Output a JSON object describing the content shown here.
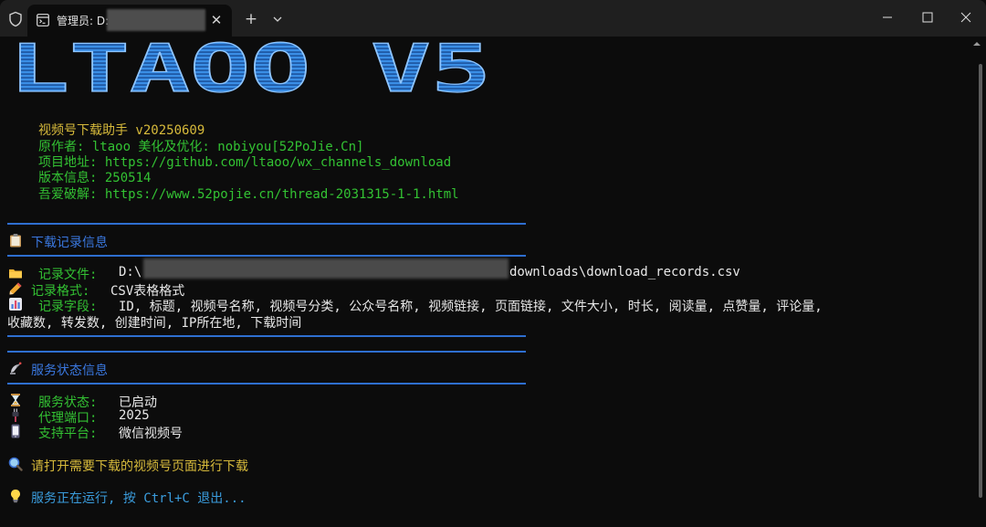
{
  "tab": {
    "title": "管理员: D:\\",
    "close": "✕",
    "new_tab": "+"
  },
  "logo": {
    "text": "LTAOO V5"
  },
  "info": {
    "name": "视频号下载助手 v20250609",
    "author": "原作者: ltaoo   美化及优化: nobiyou[52PoJie.Cn]",
    "project": "项目地址: https://github.com/ltaoo/wx_channels_download",
    "version": "版本信息: 250514",
    "wuai": "吾爱破解: https://www.52pojie.cn/thread-2031315-1-1.html"
  },
  "download_section": {
    "header": "下载记录信息",
    "file_label": "记录文件:",
    "file_prefix": "D:\\",
    "file_suffix": "downloads\\download_records.csv",
    "format_label": "记录格式:",
    "format_value": "CSV表格格式",
    "fields_label": "记录字段:",
    "fields_line1": "ID, 标题, 视频号名称, 视频号分类, 公众号名称, 视频链接, 页面链接, 文件大小, 时长, 阅读量, 点赞量, 评论量,",
    "fields_line2": "收藏数, 转发数, 创建时间, IP所在地, 下载时间"
  },
  "service_section": {
    "header": "服务状态信息",
    "status_label": "服务状态:",
    "status_value": "已启动",
    "port_label": "代理端口:",
    "port_value": "2025",
    "platform_label": "支持平台:",
    "platform_value": "微信视频号"
  },
  "prompt": "请打开需要下载的视频号页面进行下载",
  "running": "服务正在运行, 按 Ctrl+C 退出...",
  "colors": {
    "yellow": "#d7ba3b",
    "green": "#33c233",
    "blue": "#3a78e0",
    "logo": "#3a8ee6",
    "background": "#0c0c0c",
    "titlebar": "#1f1f1f"
  },
  "icons": [
    "shield-icon",
    "terminal-icon",
    "close-icon",
    "plus-icon",
    "chevron-down-icon",
    "minimize-icon",
    "maximize-icon",
    "window-close-icon",
    "clipboard-icon",
    "folder-icon",
    "pencil-icon",
    "bar-chart-icon",
    "satellite-icon",
    "hourglass-icon",
    "plug-icon",
    "mobile-icon",
    "magnifier-icon",
    "lightbulb-icon"
  ]
}
